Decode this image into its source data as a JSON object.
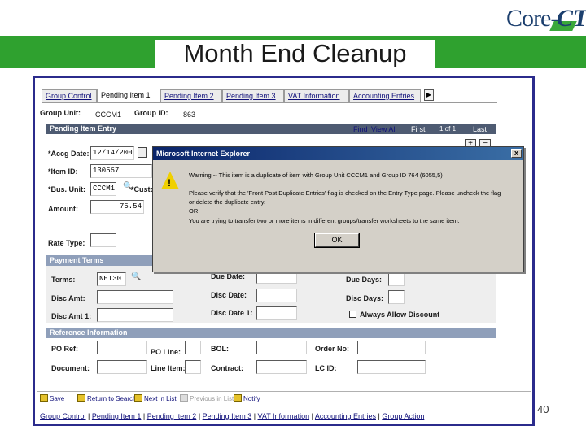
{
  "logo": {
    "core": "Core-",
    "ct": "CT"
  },
  "title": "Month End Cleanup",
  "tabs": [
    "Group Control",
    "Pending Item 1",
    "Pending Item 2",
    "Pending Item 3",
    "VAT Information",
    "Accounting Entries"
  ],
  "header": {
    "group_unit_label": "Group Unit:",
    "group_unit_value": "CCCM1",
    "group_id_label": "Group ID:",
    "group_id_value": "863"
  },
  "pending_entry": {
    "bar_label": "Pending Item Entry",
    "find": "Find",
    "view_all": "View All",
    "first": "First",
    "pager": "1 of 1",
    "last": "Last",
    "accounting_date_label": "*Accg Date:",
    "accounting_date_value": "12/14/2004",
    "item_id_label": "*Item ID:",
    "item_id_value": "130557",
    "bus_unit_label": "*Bus. Unit:",
    "bus_unit_value": "CCCM1",
    "customer_label": "*Custo",
    "amount_label": "Amount:",
    "amount_value": "75.54",
    "rate_type_label": "Rate Type:"
  },
  "payment_terms": {
    "bar_label": "Payment Terms",
    "terms_label": "Terms:",
    "terms_value": "NET30",
    "due_date_label": "Due Date:",
    "due_days_label": "Due Days:",
    "disc_amt_label": "Disc Amt:",
    "disc_date_label": "Disc Date:",
    "disc_days_label": "Disc Days:",
    "disc_amt1_label": "Disc Amt 1:",
    "disc_date1_label": "Disc Date 1:",
    "always_allow_label": "Always Allow Discount"
  },
  "reference": {
    "bar_label": "Reference Information",
    "po_ref_label": "PO Ref:",
    "po_line_label": "PO Line:",
    "bol_label": "BOL:",
    "order_no_label": "Order No:",
    "document_label": "Document:",
    "line_item_label": "Line Item:",
    "contract_label": "Contract:",
    "lc_id_label": "LC ID:"
  },
  "toolbar": {
    "save": "Save",
    "return": "Return to Search",
    "next_list": "Next in List",
    "prev_list": "Previous in List",
    "notify": "Notify"
  },
  "bottom_links": [
    "Group Control",
    "Pending Item 1",
    "Pending Item 2",
    "Pending Item 3",
    "VAT Information",
    "Accounting Entries",
    "Group Action"
  ],
  "dialog": {
    "title": "Microsoft Internet Explorer",
    "close": "x",
    "line1": "Warning -- This item is a duplicate of item with Group Unit CCCM1 and Group ID 764 (6055,5)",
    "line2": "Please verify that the 'Front Post Duplicate Entries' flag is checked on the Entry Type page. Please uncheck the flag",
    "line3": "or delete the duplicate entry.",
    "line4": "OR",
    "line5": "You are trying to transfer two or more items in different groups/transfer worksheets to the same item.",
    "ok": "OK"
  },
  "page_number": "40"
}
